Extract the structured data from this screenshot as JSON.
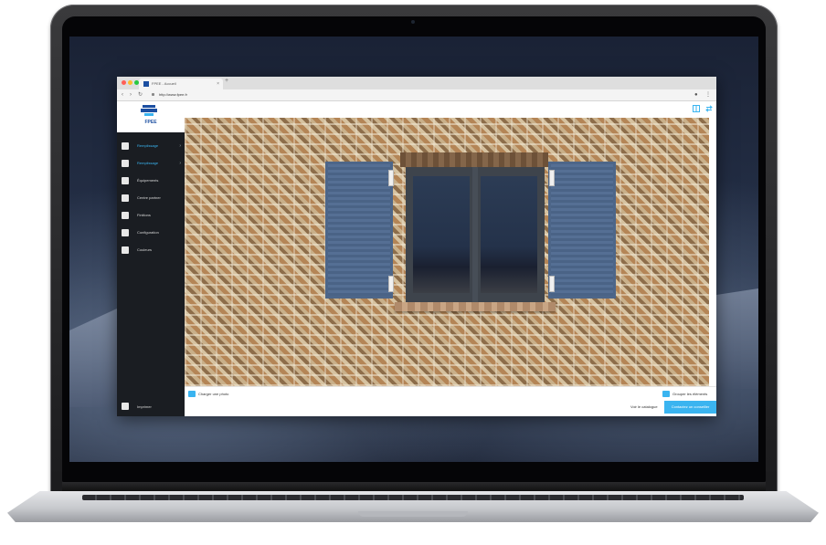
{
  "browser": {
    "tab_title": "FPEE - Accueil",
    "tab_close": "×",
    "new_tab": "+",
    "url": "http://www.fpee.fr"
  },
  "sidebar": {
    "logo": "FPEE",
    "items": [
      {
        "label": "Remplissage",
        "active": true,
        "chevron": "›"
      },
      {
        "label": "Remplissage",
        "active": true,
        "chevron": "›"
      },
      {
        "label": "Équipements",
        "active": false
      },
      {
        "label": "Centre partner",
        "active": false
      },
      {
        "label": "Finitions",
        "active": false
      },
      {
        "label": "Configuration",
        "active": false
      },
      {
        "label": "Couleurs",
        "active": false
      }
    ],
    "print_label": "Imprimer"
  },
  "content": {
    "upload_photo_label": "Charger une photo",
    "group_elements_label": "Grouper les éléments",
    "catalogue_link": "Voir le catalogue",
    "contact_button": "Contactez un conseiller"
  },
  "colors": {
    "accent": "#3ab4f0",
    "brand": "#1c4fa1",
    "sidebar_bg": "#1a1d22",
    "shutter": "#4a6386"
  }
}
